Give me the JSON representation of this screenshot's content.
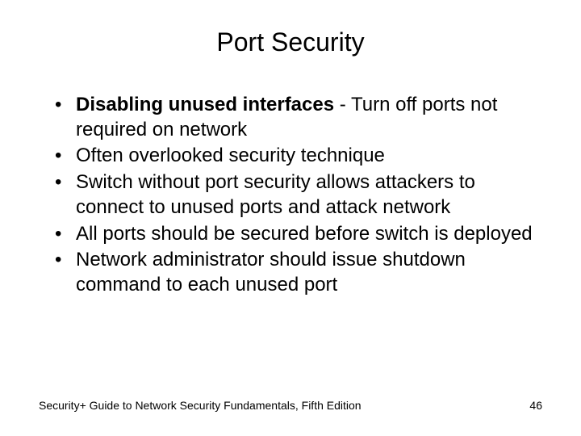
{
  "title": "Port Security",
  "bullets": [
    {
      "bold": "Disabling unused interfaces",
      "rest": " - Turn off ports not required on network"
    },
    {
      "bold": "",
      "rest": "Often overlooked security technique"
    },
    {
      "bold": "",
      "rest": "Switch without port security allows attackers to connect to unused ports and attack network"
    },
    {
      "bold": "",
      "rest": "All ports should be secured before switch is deployed"
    },
    {
      "bold": "",
      "rest": "Network administrator should issue shutdown command to each unused port"
    }
  ],
  "footer": {
    "source": "Security+ Guide to Network Security Fundamentals, Fifth Edition",
    "page": "46"
  }
}
